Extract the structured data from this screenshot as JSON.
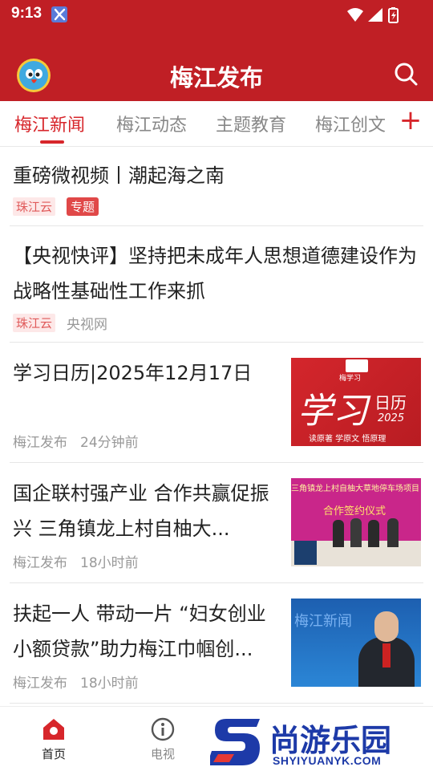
{
  "status_bar": {
    "time": "9:13"
  },
  "header": {
    "title": "梅江发布"
  },
  "tabs": [
    {
      "label": "梅江新闻",
      "active": true
    },
    {
      "label": "梅江动态",
      "active": false
    },
    {
      "label": "主题教育",
      "active": false
    },
    {
      "label": "梅江创文",
      "active": false
    }
  ],
  "tab_add_symbol": "+",
  "feed": [
    {
      "headline": "重磅微视频丨潮起海之南",
      "source_tag": "珠江云",
      "special_tag": "专题"
    },
    {
      "headline": "【央视快评】坚持把未成年人思想道德建设作为战略性基础性工作来抓",
      "source_tag": "珠江云",
      "source": "央视网"
    },
    {
      "headline": "学习日历|2025年12月17日",
      "source": "梅江发布",
      "time": "24分钟前",
      "thumb": {
        "badge": "梅学习",
        "big": "学习",
        "small": "日历",
        "year": "2025",
        "caption": "读原著 学原文 悟原理"
      }
    },
    {
      "headline": "国企联村强产业 合作共赢促振兴 三角镇龙上村自柚大...",
      "source": "梅江发布",
      "time": "18小时前",
      "thumb": {
        "banner": "三角镇龙上村自柚大草地停车场项目",
        "sub": "合作签约仪式"
      }
    },
    {
      "headline": "扶起一人 带动一片 “妇女创业小额贷款”助力梅江巾帼创...",
      "source": "梅江发布",
      "time": "18小时前",
      "thumb": {
        "studio": "梅江新闻"
      }
    }
  ],
  "bottom_nav": [
    {
      "label": "首页",
      "active": true
    },
    {
      "label": "电视",
      "active": false
    }
  ],
  "watermark": {
    "name": "尚游乐园",
    "url": "SHYIYUANYK.COM"
  },
  "colors": {
    "brand_red": "#c01f25",
    "tab_active": "#d7262b",
    "tag_bg": "#fde8e8"
  }
}
